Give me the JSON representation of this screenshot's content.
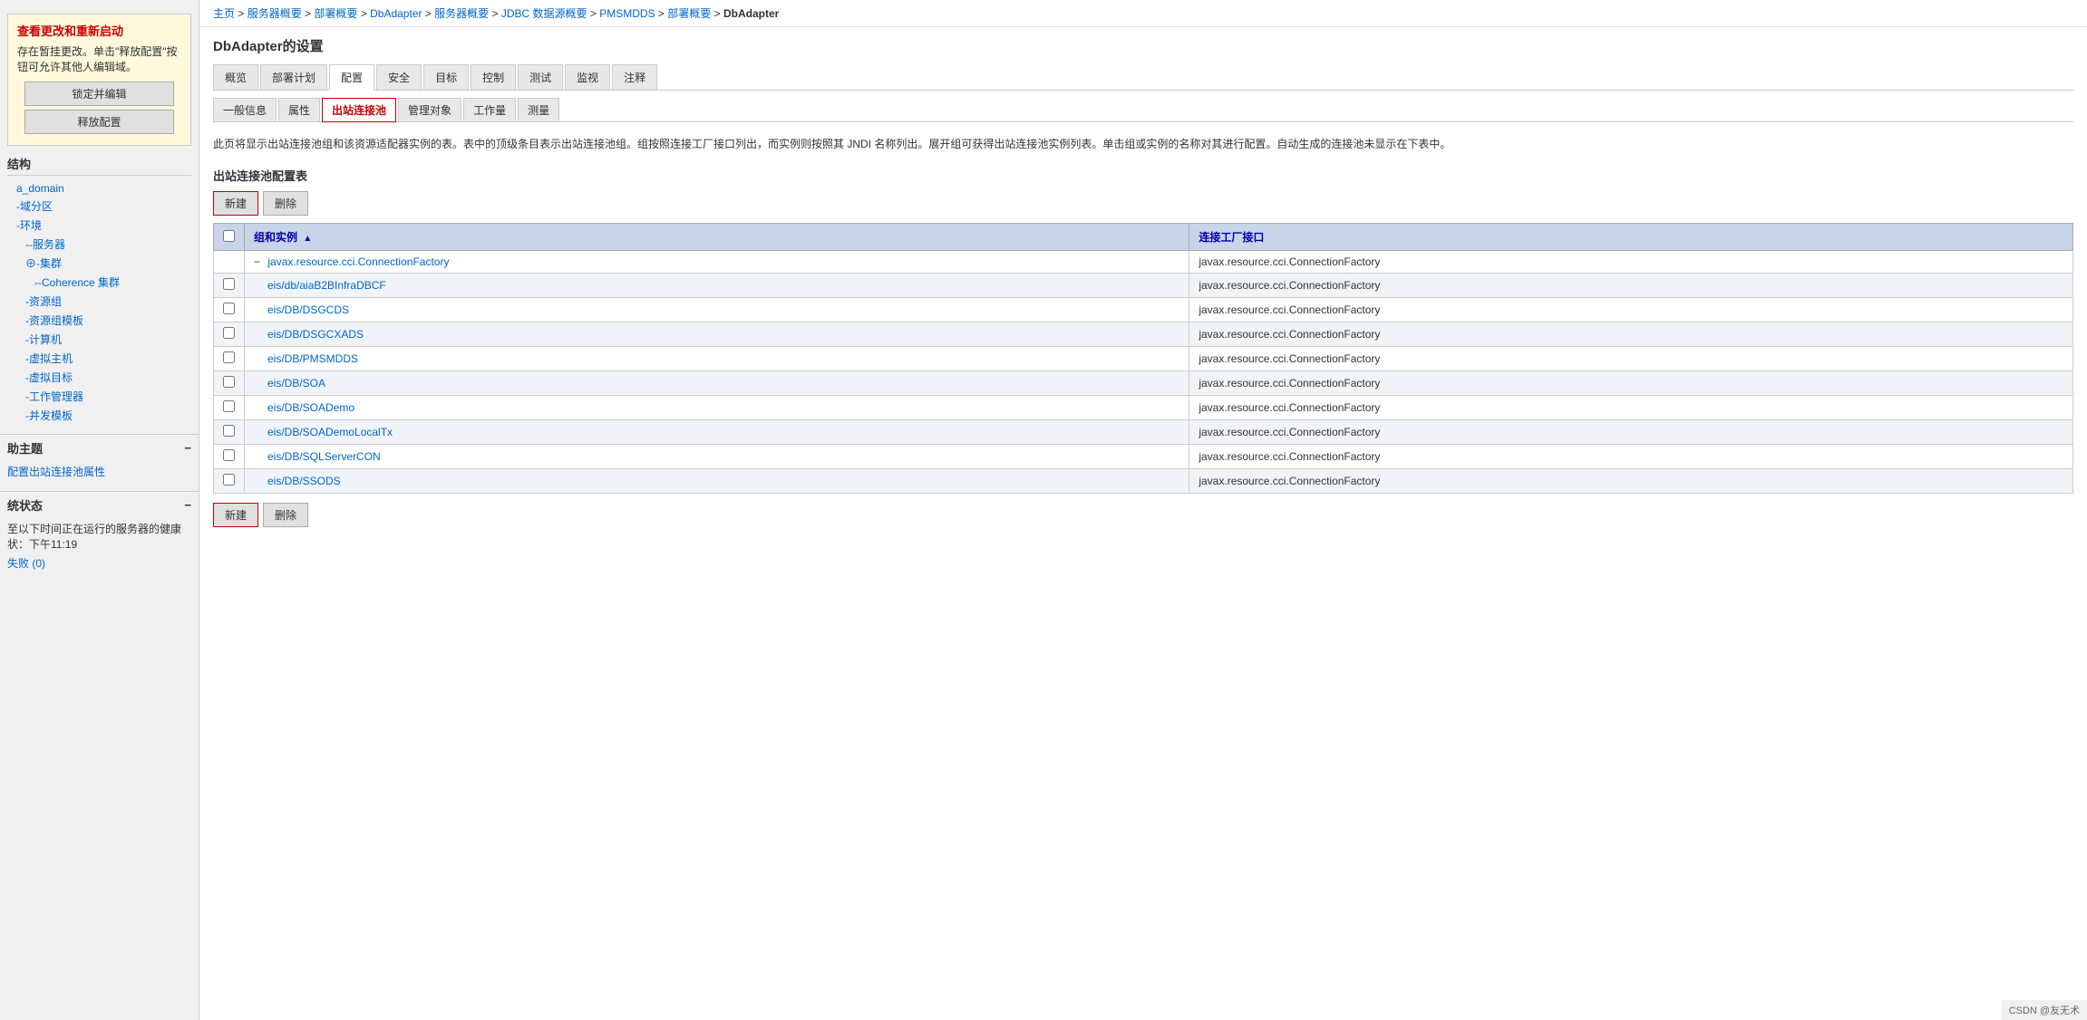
{
  "sidebar": {
    "alert": {
      "title": "查看更改和重新启动",
      "text": "存在暂挂更改。单击\"释放配置\"按钮可允许其他人编辑域。",
      "lock_btn": "锁定并编辑",
      "release_btn": "释放配置"
    },
    "structure": {
      "title": "结构",
      "items": [
        {
          "label": "a_domain",
          "indent": 1
        },
        {
          "label": "-域分区",
          "indent": 1
        },
        {
          "label": "-环境",
          "indent": 1
        },
        {
          "label": "--服务器",
          "indent": 2
        },
        {
          "label": "⊕-集群",
          "indent": 2
        },
        {
          "label": "--Coherence 集群",
          "indent": 3
        },
        {
          "label": "-资源组",
          "indent": 2
        },
        {
          "label": "-资源组模板",
          "indent": 2
        },
        {
          "label": "-计算机",
          "indent": 2
        },
        {
          "label": "-虚拟主机",
          "indent": 2
        },
        {
          "label": "-虚拟目标",
          "indent": 2
        },
        {
          "label": "-工作管理器",
          "indent": 2
        },
        {
          "label": "-并发模板",
          "indent": 2
        }
      ]
    },
    "help": {
      "title": "助主题",
      "collapse_icon": "−",
      "items": [
        "配置出站连接池属性"
      ]
    },
    "status": {
      "title": "统状态",
      "collapse_icon": "−",
      "text": "至以下时间正在运行的服务器的健康状：下午11:19",
      "failed": "失败 (0)"
    }
  },
  "breadcrumb": {
    "items": [
      "主页",
      "服务器概要",
      "部署概要",
      "DbAdapter",
      "服务器概要",
      "JDBC 数据源概要",
      "PMSMDDS",
      "部署概要",
      "DbAdapter"
    ]
  },
  "page": {
    "title": "DbAdapter的设置",
    "tabs": [
      "概览",
      "部署计划",
      "配置",
      "安全",
      "目标",
      "控制",
      "测试",
      "监视",
      "注释"
    ],
    "active_tab": "配置",
    "sub_tabs": [
      "一般信息",
      "属性",
      "出站连接池",
      "管理对象",
      "工作量",
      "测量"
    ],
    "active_sub_tab": "出站连接池",
    "description": "此页将显示出站连接池组和该资源适配器实例的表。表中的顶级条目表示出站连接池组。组按照连接工厂接口列出，而实例则按照其 JNDI 名称列出。展开组可获得出站连接池实例列表。单击组或实例的名称对其进行配置。自动生成的连接池未显示在下表中。",
    "table_title": "出站连接池配置表",
    "new_btn": "新建",
    "delete_btn": "删除",
    "columns": {
      "group_instance": "组和实例",
      "connection_factory": "连接工厂接口"
    },
    "rows": [
      {
        "type": "group",
        "name": "javax.resource.cci.ConnectionFactory",
        "factory": "javax.resource.cci.ConnectionFactory",
        "expanded": true
      },
      {
        "type": "instance",
        "name": "eis/db/aiaB2BInfraDBCF",
        "factory": "javax.resource.cci.ConnectionFactory"
      },
      {
        "type": "instance",
        "name": "eis/DB/DSGCDS",
        "factory": "javax.resource.cci.ConnectionFactory"
      },
      {
        "type": "instance",
        "name": "eis/DB/DSGCXADS",
        "factory": "javax.resource.cci.ConnectionFactory"
      },
      {
        "type": "instance",
        "name": "eis/DB/PMSMDDS",
        "factory": "javax.resource.cci.ConnectionFactory"
      },
      {
        "type": "instance",
        "name": "eis/DB/SOA",
        "factory": "javax.resource.cci.ConnectionFactory"
      },
      {
        "type": "instance",
        "name": "eis/DB/SOADemo",
        "factory": "javax.resource.cci.ConnectionFactory"
      },
      {
        "type": "instance",
        "name": "eis/DB/SOADemoLocalTx",
        "factory": "javax.resource.cci.ConnectionFactory"
      },
      {
        "type": "instance",
        "name": "eis/DB/SQLServerCON",
        "factory": "javax.resource.cci.ConnectionFactory"
      },
      {
        "type": "instance",
        "name": "eis/DB/SSODS",
        "factory": "javax.resource.cci.ConnectionFactory"
      }
    ],
    "watermark": "CSDN @友无术"
  }
}
